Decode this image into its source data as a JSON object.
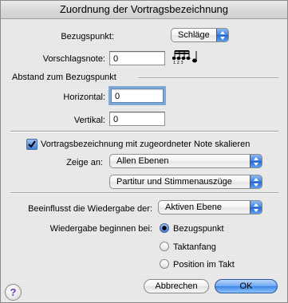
{
  "window": {
    "title": "Zuordnung der Vortragsbezeichnung"
  },
  "bezugspunkt": {
    "label": "Bezugspunkt:",
    "value": "Schläge"
  },
  "vorschlagsnote": {
    "label": "Vorschlagsnote:",
    "value": "0"
  },
  "abstand": {
    "heading": "Abstand zum Bezugspunkt",
    "horizontal_label": "Horizontal:",
    "horizontal_value": "0",
    "vertikal_label": "Vertikal:",
    "vertikal_value": "0"
  },
  "skalieren": {
    "label": "Vortragsbezeichnung mit zugeordneter Note skalieren",
    "checked": true
  },
  "zeige_an": {
    "label": "Zeige an:",
    "value": "Allen Ebenen",
    "second_value": "Partitur und Stimmenauszüge"
  },
  "beeinflusst": {
    "label": "Beeinflusst die Wiedergabe der:",
    "value": "Aktiven Ebene"
  },
  "wiedergabe": {
    "label": "Wiedergabe beginnen bei:",
    "options": [
      "Bezugspunkt",
      "Taktanfang",
      "Position im Takt"
    ],
    "selected": "Bezugspunkt"
  },
  "buttons": {
    "cancel": "Abbrechen",
    "ok": "OK",
    "help": "?"
  },
  "accent_color": "#3d86e6"
}
